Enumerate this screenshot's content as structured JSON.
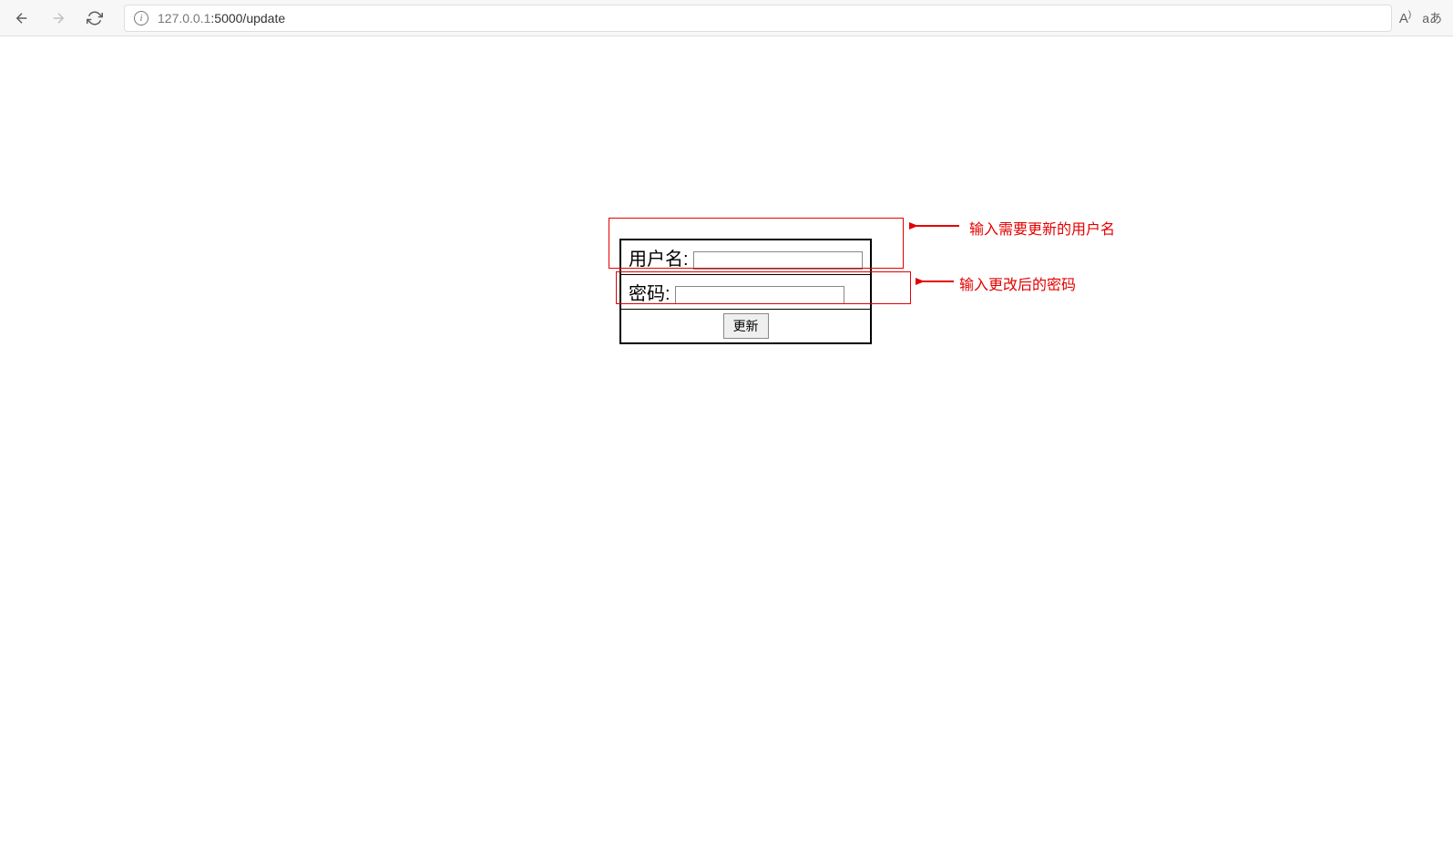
{
  "browser": {
    "url_host": "127.0.0.1",
    "url_port_path": ":5000/update",
    "read_aloud": "A",
    "translate": "aあ"
  },
  "form": {
    "username_label": "用户名:",
    "password_label": "密码:",
    "submit_label": "更新"
  },
  "annotations": {
    "username_hint": "输入需要更新的用户名",
    "password_hint": "输入更改后的密码"
  }
}
